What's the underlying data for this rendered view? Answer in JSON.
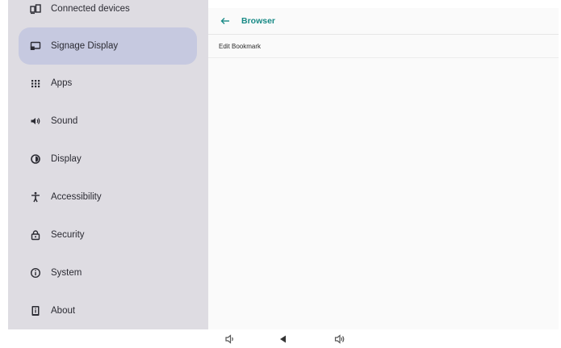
{
  "sidebar": {
    "items": [
      {
        "label": "Connected devices",
        "icon": "connected-devices-icon"
      },
      {
        "label": "Signage Display",
        "icon": "signage-display-icon",
        "selected": true
      },
      {
        "label": "Apps",
        "icon": "apps-grid-icon"
      },
      {
        "label": "Sound",
        "icon": "speaker-icon"
      },
      {
        "label": "Display",
        "icon": "brightness-icon"
      },
      {
        "label": "Accessibility",
        "icon": "accessibility-icon"
      },
      {
        "label": "Security",
        "icon": "lock-icon"
      },
      {
        "label": "System",
        "icon": "info-icon"
      },
      {
        "label": "About",
        "icon": "tablet-info-icon"
      }
    ]
  },
  "main": {
    "header": {
      "title": "Browser",
      "back_icon": "back-arrow-icon"
    },
    "rows": [
      {
        "label": "Edit Bookmark"
      }
    ]
  },
  "navbar": {
    "buttons": [
      {
        "icon": "volume-down-icon"
      },
      {
        "icon": "back-triangle-icon"
      },
      {
        "icon": "volume-up-icon"
      }
    ]
  },
  "colors": {
    "sidebar_bg": "#dedce2",
    "selected_item_bg": "#c6c9e0",
    "accent": "#188a86",
    "content_bg": "#fafafa"
  }
}
